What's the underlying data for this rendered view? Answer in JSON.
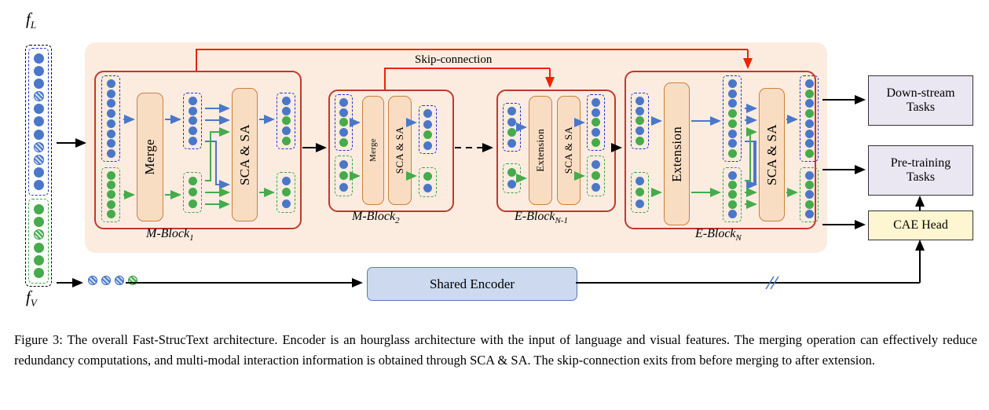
{
  "figure": {
    "number": "Figure 3:",
    "caption": "Figure 3: The overall Fast-StrucText architecture. Encoder is an hourglass architecture with the input of language and visual features. The merging operation can effectively reduce redundancy computations, and multi-modal interaction information is obtained through SCA & SA. The skip-connection exits from before merging to after extension."
  },
  "inputs": {
    "language_label": "f",
    "language_sub": "L",
    "visual_label": "f",
    "visual_sub": "V"
  },
  "annotations": {
    "skip_connection": "Skip-connection"
  },
  "blocks": [
    {
      "id": "m-block-1",
      "label": "M-Block",
      "sub": "1",
      "modules": [
        "Merge",
        "SCA & SA"
      ],
      "in_blue": [
        "b",
        "b",
        "b",
        "b",
        "b",
        "b",
        "b",
        "b"
      ],
      "in_green": [
        "g",
        "g",
        "g",
        "g",
        "g"
      ],
      "mid_blue": [
        "b",
        "b",
        "b",
        "b",
        "b"
      ],
      "mid_green": [
        "g",
        "g",
        "g"
      ],
      "out_blue": [
        "b",
        "b",
        "g",
        "b",
        "g"
      ],
      "out_green": [
        "b",
        "g",
        "b"
      ]
    },
    {
      "id": "m-block-2",
      "label": "M-Block",
      "sub": "2",
      "modules": [
        "Merge",
        "SCA & SA"
      ],
      "in_blue": [
        "b",
        "b",
        "g",
        "b",
        "g"
      ],
      "in_green": [
        "b",
        "g",
        "b"
      ],
      "out_blue": [
        "b",
        "b",
        "g",
        "b"
      ],
      "out_green": [
        "g",
        "b"
      ]
    },
    {
      "id": "e-block-n-1",
      "label": "E-Block",
      "sub": "N-1",
      "modules": [
        "Extension",
        "SCA & SA"
      ],
      "in_blue": [
        "b",
        "b",
        "g",
        "b"
      ],
      "in_green": [
        "g",
        "b"
      ],
      "out_blue": [
        "b",
        "b",
        "g",
        "b",
        "g"
      ],
      "out_green": [
        "b",
        "g",
        "b"
      ]
    },
    {
      "id": "e-block-n",
      "label": "E-Block",
      "sub": "N",
      "modules": [
        "Extension",
        "SCA & SA"
      ],
      "in_blue": [
        "b",
        "b",
        "g",
        "b",
        "g"
      ],
      "in_green": [
        "b",
        "g",
        "b"
      ],
      "mid_blue": [
        "b",
        "b",
        "b",
        "g",
        "g",
        "b",
        "b",
        "g"
      ],
      "mid_green": [
        "b",
        "g",
        "g",
        "g",
        "b"
      ],
      "out_blue": [
        "b",
        "g",
        "b",
        "g",
        "b",
        "b",
        "b",
        "g"
      ],
      "out_green": [
        "b",
        "g",
        "b",
        "g",
        "b"
      ]
    }
  ],
  "input_column": {
    "language_tokens": [
      "b",
      "b",
      "b",
      "bh",
      "b",
      "b",
      "b",
      "bh",
      "bh",
      "b",
      "b"
    ],
    "visual_tokens": [
      "g",
      "g",
      "gh",
      "g",
      "g",
      "g"
    ]
  },
  "masked_tokens": [
    "bh",
    "bh",
    "bh",
    "gh"
  ],
  "right_boxes": {
    "downstream": "Down-stream\nTasks",
    "downstream_line1": "Down-stream",
    "downstream_line2": "Tasks",
    "pretraining_line1": "Pre-training",
    "pretraining_line2": "Tasks",
    "cae_head": "CAE Head"
  },
  "shared_encoder": {
    "label": "Shared Encoder"
  },
  "colors": {
    "blue_token": "#4b77c9",
    "green_token": "#45ab4c",
    "block_border": "#c0392b",
    "module_fill": "#f9ddc3",
    "module_border": "#c8813c",
    "panel_fill": "#fcece0",
    "task_fill": "#eae6f2",
    "cae_fill": "#fdf6d0",
    "encoder_fill": "#ccd9ef",
    "skip_color": "#ee2200"
  }
}
